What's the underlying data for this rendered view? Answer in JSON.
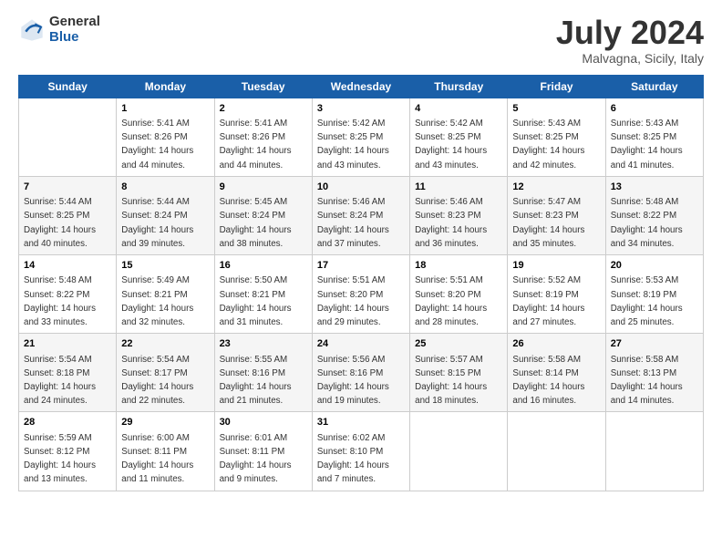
{
  "logo": {
    "general": "General",
    "blue": "Blue"
  },
  "title": "July 2024",
  "subtitle": "Malvagna, Sicily, Italy",
  "days_header": [
    "Sunday",
    "Monday",
    "Tuesday",
    "Wednesday",
    "Thursday",
    "Friday",
    "Saturday"
  ],
  "weeks": [
    [
      {
        "day": "",
        "sunrise": "",
        "sunset": "",
        "daylight": ""
      },
      {
        "day": "1",
        "sunrise": "Sunrise: 5:41 AM",
        "sunset": "Sunset: 8:26 PM",
        "daylight": "Daylight: 14 hours and 44 minutes."
      },
      {
        "day": "2",
        "sunrise": "Sunrise: 5:41 AM",
        "sunset": "Sunset: 8:26 PM",
        "daylight": "Daylight: 14 hours and 44 minutes."
      },
      {
        "day": "3",
        "sunrise": "Sunrise: 5:42 AM",
        "sunset": "Sunset: 8:25 PM",
        "daylight": "Daylight: 14 hours and 43 minutes."
      },
      {
        "day": "4",
        "sunrise": "Sunrise: 5:42 AM",
        "sunset": "Sunset: 8:25 PM",
        "daylight": "Daylight: 14 hours and 43 minutes."
      },
      {
        "day": "5",
        "sunrise": "Sunrise: 5:43 AM",
        "sunset": "Sunset: 8:25 PM",
        "daylight": "Daylight: 14 hours and 42 minutes."
      },
      {
        "day": "6",
        "sunrise": "Sunrise: 5:43 AM",
        "sunset": "Sunset: 8:25 PM",
        "daylight": "Daylight: 14 hours and 41 minutes."
      }
    ],
    [
      {
        "day": "7",
        "sunrise": "Sunrise: 5:44 AM",
        "sunset": "Sunset: 8:25 PM",
        "daylight": "Daylight: 14 hours and 40 minutes."
      },
      {
        "day": "8",
        "sunrise": "Sunrise: 5:44 AM",
        "sunset": "Sunset: 8:24 PM",
        "daylight": "Daylight: 14 hours and 39 minutes."
      },
      {
        "day": "9",
        "sunrise": "Sunrise: 5:45 AM",
        "sunset": "Sunset: 8:24 PM",
        "daylight": "Daylight: 14 hours and 38 minutes."
      },
      {
        "day": "10",
        "sunrise": "Sunrise: 5:46 AM",
        "sunset": "Sunset: 8:24 PM",
        "daylight": "Daylight: 14 hours and 37 minutes."
      },
      {
        "day": "11",
        "sunrise": "Sunrise: 5:46 AM",
        "sunset": "Sunset: 8:23 PM",
        "daylight": "Daylight: 14 hours and 36 minutes."
      },
      {
        "day": "12",
        "sunrise": "Sunrise: 5:47 AM",
        "sunset": "Sunset: 8:23 PM",
        "daylight": "Daylight: 14 hours and 35 minutes."
      },
      {
        "day": "13",
        "sunrise": "Sunrise: 5:48 AM",
        "sunset": "Sunset: 8:22 PM",
        "daylight": "Daylight: 14 hours and 34 minutes."
      }
    ],
    [
      {
        "day": "14",
        "sunrise": "Sunrise: 5:48 AM",
        "sunset": "Sunset: 8:22 PM",
        "daylight": "Daylight: 14 hours and 33 minutes."
      },
      {
        "day": "15",
        "sunrise": "Sunrise: 5:49 AM",
        "sunset": "Sunset: 8:21 PM",
        "daylight": "Daylight: 14 hours and 32 minutes."
      },
      {
        "day": "16",
        "sunrise": "Sunrise: 5:50 AM",
        "sunset": "Sunset: 8:21 PM",
        "daylight": "Daylight: 14 hours and 31 minutes."
      },
      {
        "day": "17",
        "sunrise": "Sunrise: 5:51 AM",
        "sunset": "Sunset: 8:20 PM",
        "daylight": "Daylight: 14 hours and 29 minutes."
      },
      {
        "day": "18",
        "sunrise": "Sunrise: 5:51 AM",
        "sunset": "Sunset: 8:20 PM",
        "daylight": "Daylight: 14 hours and 28 minutes."
      },
      {
        "day": "19",
        "sunrise": "Sunrise: 5:52 AM",
        "sunset": "Sunset: 8:19 PM",
        "daylight": "Daylight: 14 hours and 27 minutes."
      },
      {
        "day": "20",
        "sunrise": "Sunrise: 5:53 AM",
        "sunset": "Sunset: 8:19 PM",
        "daylight": "Daylight: 14 hours and 25 minutes."
      }
    ],
    [
      {
        "day": "21",
        "sunrise": "Sunrise: 5:54 AM",
        "sunset": "Sunset: 8:18 PM",
        "daylight": "Daylight: 14 hours and 24 minutes."
      },
      {
        "day": "22",
        "sunrise": "Sunrise: 5:54 AM",
        "sunset": "Sunset: 8:17 PM",
        "daylight": "Daylight: 14 hours and 22 minutes."
      },
      {
        "day": "23",
        "sunrise": "Sunrise: 5:55 AM",
        "sunset": "Sunset: 8:16 PM",
        "daylight": "Daylight: 14 hours and 21 minutes."
      },
      {
        "day": "24",
        "sunrise": "Sunrise: 5:56 AM",
        "sunset": "Sunset: 8:16 PM",
        "daylight": "Daylight: 14 hours and 19 minutes."
      },
      {
        "day": "25",
        "sunrise": "Sunrise: 5:57 AM",
        "sunset": "Sunset: 8:15 PM",
        "daylight": "Daylight: 14 hours and 18 minutes."
      },
      {
        "day": "26",
        "sunrise": "Sunrise: 5:58 AM",
        "sunset": "Sunset: 8:14 PM",
        "daylight": "Daylight: 14 hours and 16 minutes."
      },
      {
        "day": "27",
        "sunrise": "Sunrise: 5:58 AM",
        "sunset": "Sunset: 8:13 PM",
        "daylight": "Daylight: 14 hours and 14 minutes."
      }
    ],
    [
      {
        "day": "28",
        "sunrise": "Sunrise: 5:59 AM",
        "sunset": "Sunset: 8:12 PM",
        "daylight": "Daylight: 14 hours and 13 minutes."
      },
      {
        "day": "29",
        "sunrise": "Sunrise: 6:00 AM",
        "sunset": "Sunset: 8:11 PM",
        "daylight": "Daylight: 14 hours and 11 minutes."
      },
      {
        "day": "30",
        "sunrise": "Sunrise: 6:01 AM",
        "sunset": "Sunset: 8:11 PM",
        "daylight": "Daylight: 14 hours and 9 minutes."
      },
      {
        "day": "31",
        "sunrise": "Sunrise: 6:02 AM",
        "sunset": "Sunset: 8:10 PM",
        "daylight": "Daylight: 14 hours and 7 minutes."
      },
      {
        "day": "",
        "sunrise": "",
        "sunset": "",
        "daylight": ""
      },
      {
        "day": "",
        "sunrise": "",
        "sunset": "",
        "daylight": ""
      },
      {
        "day": "",
        "sunrise": "",
        "sunset": "",
        "daylight": ""
      }
    ]
  ]
}
